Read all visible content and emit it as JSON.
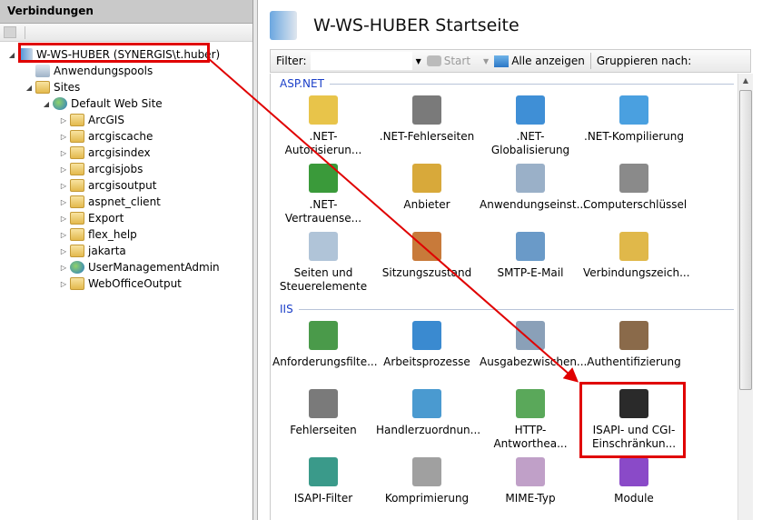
{
  "left": {
    "header": "Verbindungen",
    "tree": [
      {
        "label": "W-WS-HUBER (SYNERGIS\\t.huber)",
        "icon": "server-icon",
        "level": 0,
        "expanded": true,
        "highlighted": true
      },
      {
        "label": "Anwendungspools",
        "icon": "app-pool-icon",
        "level": 1
      },
      {
        "label": "Sites",
        "icon": "sites-folder-icon",
        "level": 1,
        "expanded": true
      },
      {
        "label": "Default Web Site",
        "icon": "globe-icon",
        "level": 2,
        "expanded": true
      },
      {
        "label": "ArcGIS",
        "icon": "folder-icon",
        "level": 3
      },
      {
        "label": "arcgiscache",
        "icon": "folder-icon",
        "level": 3
      },
      {
        "label": "arcgisindex",
        "icon": "folder-icon",
        "level": 3
      },
      {
        "label": "arcgisjobs",
        "icon": "folder-icon",
        "level": 3
      },
      {
        "label": "arcgisoutput",
        "icon": "folder-icon",
        "level": 3
      },
      {
        "label": "aspnet_client",
        "icon": "folder-icon",
        "level": 3
      },
      {
        "label": "Export",
        "icon": "folder-icon",
        "level": 3
      },
      {
        "label": "flex_help",
        "icon": "folder-icon",
        "level": 3
      },
      {
        "label": "jakarta",
        "icon": "folder-icon",
        "level": 3
      },
      {
        "label": "UserManagementAdmin",
        "icon": "globe-icon",
        "level": 3
      },
      {
        "label": "WebOfficeOutput",
        "icon": "folder-icon",
        "level": 3
      }
    ]
  },
  "main": {
    "title": "W-WS-HUBER Startseite",
    "filter_label": "Filter:",
    "filter_value": "",
    "start_label": "Start",
    "show_all_label": "Alle anzeigen",
    "group_by_label": "Gruppieren nach:",
    "groups": [
      {
        "name": "ASP.NET",
        "items": [
          {
            "label": ".NET-Autorisierun...",
            "color": "#e8c44a"
          },
          {
            "label": ".NET-Fehlerseiten",
            "color": "#7a7a7a"
          },
          {
            "label": ".NET-Globalisierung",
            "color": "#3f8fd6"
          },
          {
            "label": ".NET-Kompilierung",
            "color": "#4aa0e0"
          },
          {
            "label": ".NET-Vertrauense...",
            "color": "#3a9a3a"
          },
          {
            "label": "Anbieter",
            "color": "#d8a93a"
          },
          {
            "label": "Anwendungseinst...",
            "color": "#9ab0c8"
          },
          {
            "label": "Computerschlüssel",
            "color": "#8a8a8a"
          },
          {
            "label": "Seiten und Steuerelemente",
            "color": "#b0c4d8"
          },
          {
            "label": "Sitzungszustand",
            "color": "#c87a3a"
          },
          {
            "label": "SMTP-E-Mail",
            "color": "#6a9ac8"
          },
          {
            "label": "Verbindungszeich...",
            "color": "#e0b84a"
          }
        ]
      },
      {
        "name": "IIS",
        "items": [
          {
            "label": "Anforderungsfilte...",
            "color": "#4a9a4a"
          },
          {
            "label": "Arbeitsprozesse",
            "color": "#3a8ad0"
          },
          {
            "label": "Ausgabezwischen...",
            "color": "#8aa0b8"
          },
          {
            "label": "Authentifizierung",
            "color": "#8a6a4a"
          },
          {
            "label": "Fehlerseiten",
            "color": "#7a7a7a"
          },
          {
            "label": "Handlerzuordnun...",
            "color": "#4a9ad0"
          },
          {
            "label": "HTTP-Antwortheа...",
            "color": "#5aa85a"
          },
          {
            "label": "ISAPI- und CGI-Einschränkun...",
            "color": "#2a2a2a",
            "highlighted": true
          },
          {
            "label": "ISAPI-Filter",
            "color": "#3a9a8a"
          },
          {
            "label": "Komprimierung",
            "color": "#a0a0a0"
          },
          {
            "label": "MIME-Typ",
            "color": "#c0a0c8"
          },
          {
            "label": "Module",
            "color": "#8a4ac8"
          }
        ]
      }
    ]
  },
  "colors": {
    "highlight": "#e00000",
    "group_header": "#1a3ec8"
  }
}
